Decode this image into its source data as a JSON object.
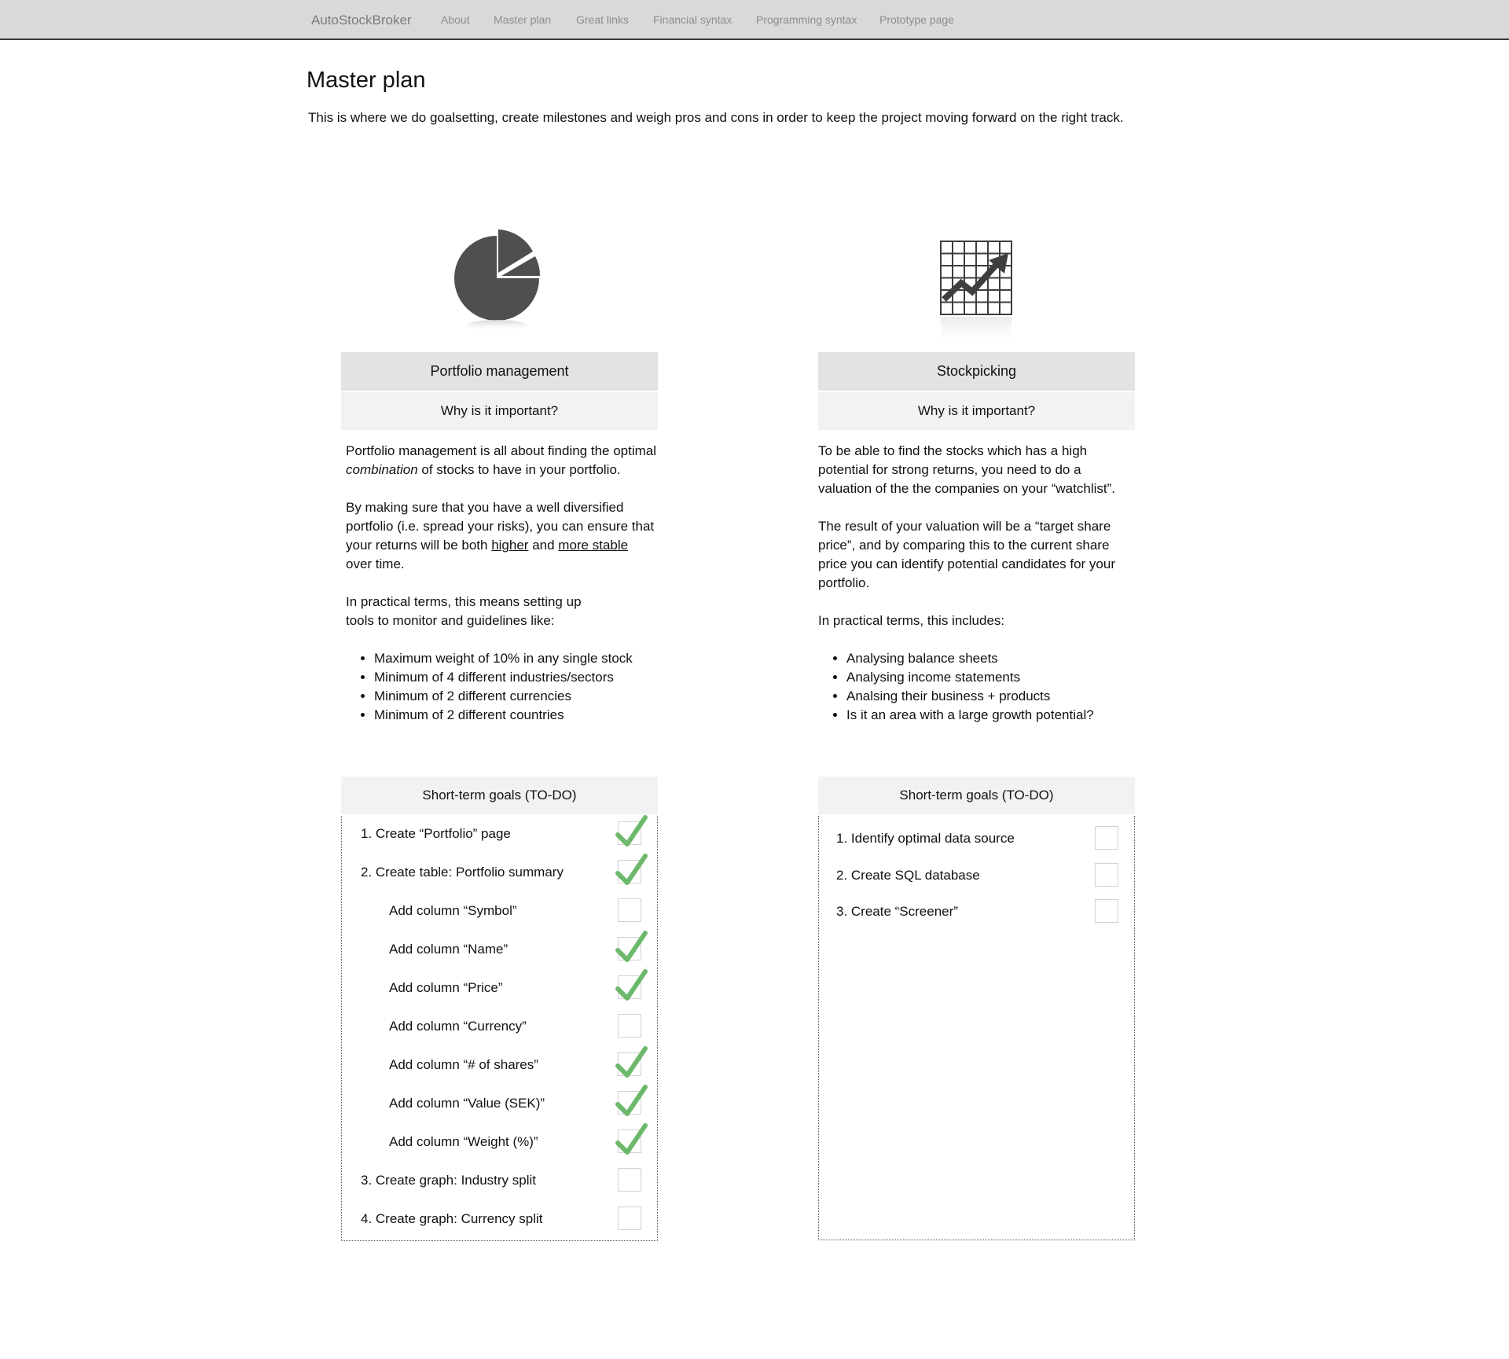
{
  "nav": {
    "brand": "AutoStockBroker",
    "links": [
      "About",
      "Master plan",
      "Great links",
      "Financial syntax",
      "Programming syntax",
      "Prototype page"
    ]
  },
  "header": {
    "title": "Master plan",
    "intro": "This is where we do goalsetting, create milestones and weigh pros and cons in order to keep the project moving forward on the right track."
  },
  "colors": {
    "check": "#6cb96c",
    "icon": "#4f4f4f",
    "navbar": "#d9d9d9"
  },
  "portfolio": {
    "icon": "pie-chart-icon",
    "title": "Portfolio management",
    "subtitle": "Why is it important?",
    "p1_a": "Portfolio management is all about finding the optimal ",
    "p1_em": "combination",
    "p1_b": " of stocks to have in your portfolio.",
    "p2_a": "By making sure that you have a well diversified portfolio (i.e. spread your risks), you can ensure that your returns will be both ",
    "p2_u1": "higher",
    "p2_mid": " and ",
    "p2_u2": "more stable",
    "p2_b": " over time.",
    "p3": "In practical terms, this means setting up tools to monitor and guidelines like:",
    "bullets": [
      "Maximum weight of 10% in any single stock",
      "Minimum of 4 different industries/sectors",
      "Minimum of 2 different currencies",
      "Minimum of 2 different countries"
    ],
    "goals_title": "Short-term goals (TO-DO)",
    "goals": [
      {
        "label": "1. Create “Portfolio” page",
        "done": true,
        "indent": false
      },
      {
        "label": "2. Create table: Portfolio summary",
        "done": true,
        "indent": false
      },
      {
        "label": "Add column “Symbol”",
        "done": false,
        "indent": true
      },
      {
        "label": "Add column “Name”",
        "done": true,
        "indent": true
      },
      {
        "label": "Add column “Price”",
        "done": true,
        "indent": true
      },
      {
        "label": "Add column “Currency”",
        "done": false,
        "indent": true
      },
      {
        "label": "Add column “# of shares”",
        "done": true,
        "indent": true
      },
      {
        "label": "Add column “Value (SEK)”",
        "done": true,
        "indent": true
      },
      {
        "label": "Add column “Weight (%)”",
        "done": true,
        "indent": true
      },
      {
        "label": "3. Create graph: Industry split",
        "done": false,
        "indent": false
      },
      {
        "label": "4. Create graph: Currency split",
        "done": false,
        "indent": false
      }
    ]
  },
  "stockpicking": {
    "icon": "stock-chart-icon",
    "title": "Stockpicking",
    "subtitle": "Why is it important?",
    "p1": "To be able to find the stocks which has a high potential for strong returns, you need to do a valuation of the the companies on your “watchlist”.",
    "p2": "The result of your valuation will be a “target share price”, and by comparing this to the current share price you can identify potential candidates for your portfolio.",
    "p3": "In practical terms, this includes:",
    "bullets": [
      "Analysing balance sheets",
      "Analysing income statements",
      "Analsing their business + products",
      "Is it an area with a large growth potential?"
    ],
    "goals_title": "Short-term goals (TO-DO)",
    "goals": [
      {
        "label": "1. Identify optimal data source",
        "done": false
      },
      {
        "label": "2. Create SQL database",
        "done": false
      },
      {
        "label": "3. Create “Screener”",
        "done": false
      }
    ]
  }
}
